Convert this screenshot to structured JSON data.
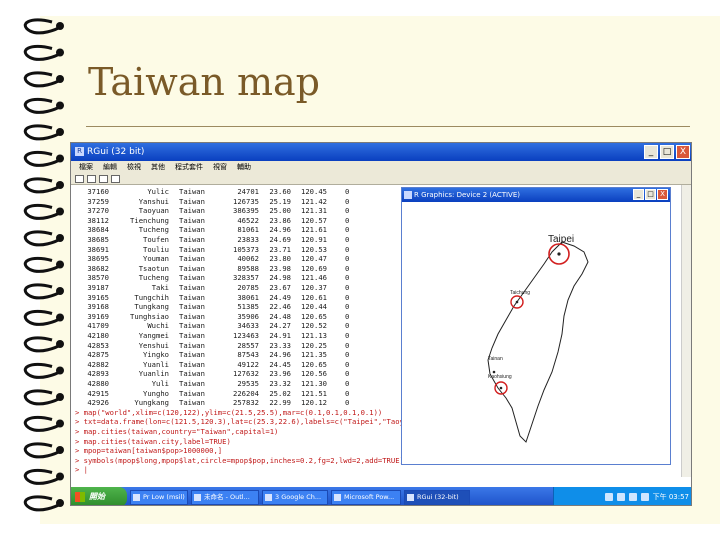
{
  "slide": {
    "title": "Taiwan map"
  },
  "rgui": {
    "window_title": "RGui (32 bit)",
    "menu": [
      "檔案",
      "編輯",
      "檢視",
      "其他",
      "程式套件",
      "視窗",
      "輔助"
    ],
    "controls": {
      "minimize": "_",
      "maximize": "□",
      "close": "X"
    }
  },
  "console": {
    "rows": [
      [
        "37160",
        "Yulic",
        "Taiwan",
        "24701",
        "23.60",
        "120.45",
        "0"
      ],
      [
        "37259",
        "Yanshui",
        "Taiwan",
        "126735",
        "25.19",
        "121.42",
        "0"
      ],
      [
        "37270",
        "Taoyuan",
        "Taiwan",
        "386395",
        "25.00",
        "121.31",
        "0"
      ],
      [
        "38112",
        "Tienchung",
        "Taiwan",
        "46522",
        "23.86",
        "120.57",
        "0"
      ],
      [
        "38684",
        "Tucheng",
        "Taiwan",
        "81061",
        "24.96",
        "121.61",
        "0"
      ],
      [
        "38685",
        "Toufen",
        "Taiwan",
        "23833",
        "24.69",
        "120.91",
        "0"
      ],
      [
        "38691",
        "Touliu",
        "Taiwan",
        "105373",
        "23.71",
        "120.53",
        "0"
      ],
      [
        "38695",
        "Youman",
        "Taiwan",
        "40062",
        "23.80",
        "120.47",
        "0"
      ],
      [
        "38682",
        "Tsaotun",
        "Taiwan",
        "89588",
        "23.98",
        "120.69",
        "0"
      ],
      [
        "38570",
        "Tucheng",
        "Taiwan",
        "328357",
        "24.98",
        "121.46",
        "0"
      ],
      [
        "39187",
        "Taki",
        "Taiwan",
        "20785",
        "23.67",
        "120.37",
        "0"
      ],
      [
        "39165",
        "Tungchih",
        "Taiwan",
        "38061",
        "24.49",
        "120.61",
        "0"
      ],
      [
        "39168",
        "Tungkang",
        "Taiwan",
        "51385",
        "22.46",
        "120.44",
        "0"
      ],
      [
        "39169",
        "Tunghsiao",
        "Taiwan",
        "35906",
        "24.48",
        "120.65",
        "0"
      ],
      [
        "41709",
        "Wuchi",
        "Taiwan",
        "34633",
        "24.27",
        "120.52",
        "0"
      ],
      [
        "42180",
        "Yangmei",
        "Taiwan",
        "123463",
        "24.91",
        "121.13",
        "0"
      ],
      [
        "42853",
        "Yenshui",
        "Taiwan",
        "28557",
        "23.33",
        "120.25",
        "0"
      ],
      [
        "42875",
        "Yingko",
        "Taiwan",
        "87543",
        "24.96",
        "121.35",
        "0"
      ],
      [
        "42882",
        "Yuanli",
        "Taiwan",
        "49122",
        "24.45",
        "120.65",
        "0"
      ],
      [
        "42893",
        "Yuanlin",
        "Taiwan",
        "127632",
        "23.96",
        "120.56",
        "0"
      ],
      [
        "42880",
        "Yuli",
        "Taiwan",
        "29535",
        "23.32",
        "121.30",
        "0"
      ],
      [
        "42915",
        "Yungho",
        "Taiwan",
        "226204",
        "25.02",
        "121.51",
        "0"
      ],
      [
        "42926",
        "Yungkang",
        "Taiwan",
        "257832",
        "22.99",
        "120.12",
        "0"
      ]
    ],
    "commands": [
      "> map(\"world\",xlim=c(120,122),ylim=c(21.5,25.5),mar=c(0.1,0.1,0.1,0.1))",
      "> txt=data.frame(lon=c(121.5,120.3),lat=c(25.3,22.6),labels=c(\"Taipei\",\"Taoyuan\",\"Taichung\"))",
      "> map.cities(taiwan,country=\"Taiwan\",capital=1)",
      "> map.cities(taiwan.city,label=TRUE)",
      "> mpop=taiwan[taiwan$pop>1000000,]",
      "> symbols(mpop$long,mpop$lat,circle=mpop$pop,inches=0.2,fg=2,lwd=2,add=TRUE)"
    ],
    "prompt": "> |"
  },
  "graphics_device": {
    "window_title": "R Graphics: Device 2 (ACTIVE)",
    "cities": [
      "Taipei",
      "Taichung",
      "Tainan",
      "Kaohsiung"
    ]
  },
  "taskbar": {
    "start": "開始",
    "items": [
      "Pr Low (msil)",
      "未命名 - Outl...",
      "3 Google Ch...",
      "Microsoft Pow...",
      "RGui (32-bit)"
    ],
    "clock": "下午 03:57"
  }
}
